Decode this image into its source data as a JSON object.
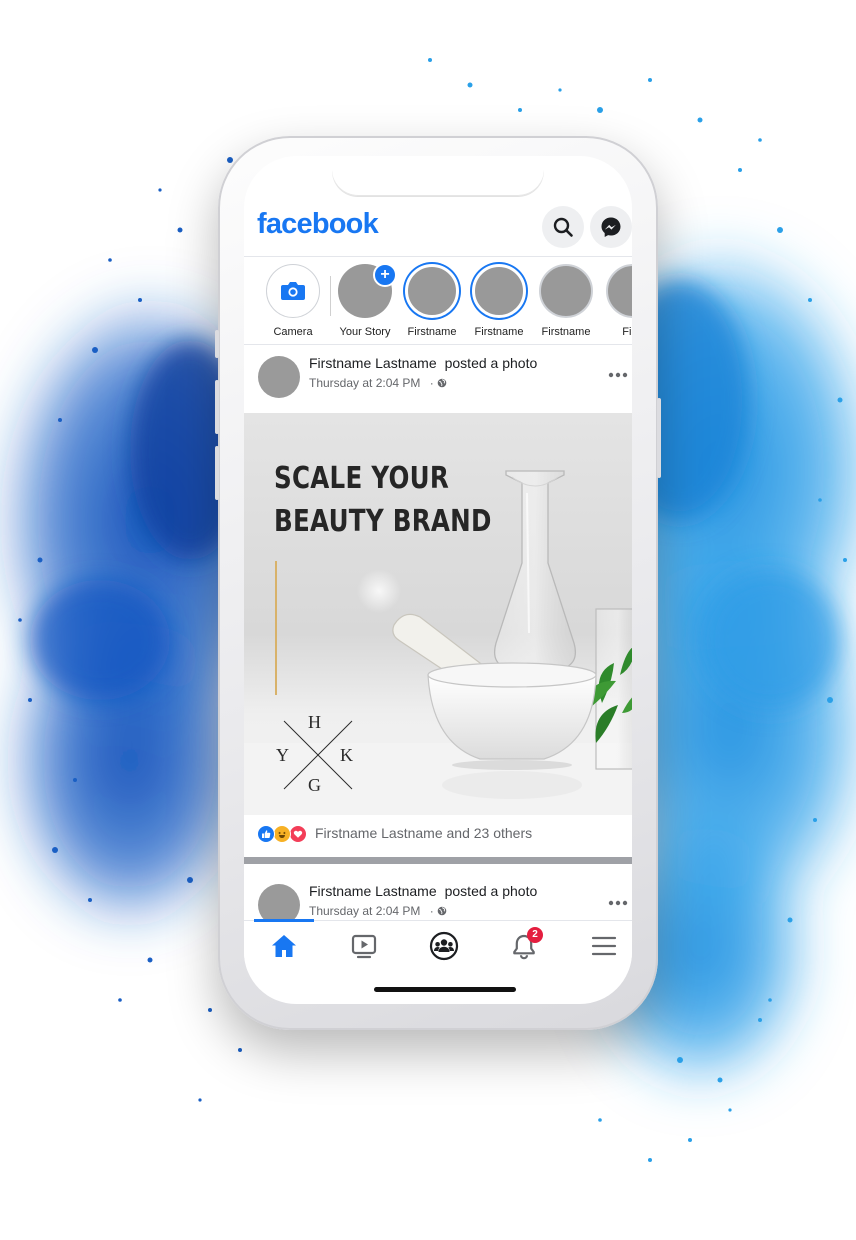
{
  "app": {
    "name": "facebook",
    "accent_color": "#1877f2",
    "icons": {
      "search": "search-icon",
      "messenger": "messenger-icon"
    }
  },
  "stories": [
    {
      "label": "Camera",
      "type": "camera",
      "icon": "camera-icon"
    },
    {
      "label": "Your Story",
      "type": "add",
      "icon": "plus-icon"
    },
    {
      "label": "Firstname",
      "type": "unseen"
    },
    {
      "label": "Firstname",
      "type": "unseen"
    },
    {
      "label": "Firstname",
      "type": "seen"
    },
    {
      "label": "First",
      "type": "seen"
    }
  ],
  "post": {
    "author": "Firstname Lastname",
    "action": "posted a photo",
    "time": "Thursday at 2:04 PM",
    "separator": "·",
    "privacy_icon": "globe-icon",
    "image": {
      "headline_line1": "SCALE YOUR",
      "headline_line2": "BEAUTY BRAND",
      "monogram": {
        "top": "H",
        "left": "Y",
        "right": "K",
        "bottom": "G"
      }
    },
    "reactions": {
      "types": [
        "like",
        "haha",
        "love"
      ],
      "text": "Firstname Lastname and 23 others"
    }
  },
  "post2": {
    "author": "Firstname Lastname",
    "action": "posted a photo",
    "time": "Thursday at 2:04 PM",
    "separator": "·"
  },
  "nav": {
    "items": [
      {
        "name": "home",
        "icon": "home-icon",
        "active": true
      },
      {
        "name": "watch",
        "icon": "video-icon",
        "active": false
      },
      {
        "name": "groups",
        "icon": "groups-icon",
        "active": false
      },
      {
        "name": "notifications",
        "icon": "bell-icon",
        "active": false,
        "badge": "2"
      },
      {
        "name": "menu",
        "icon": "hamburger-menu-icon",
        "active": false
      }
    ]
  }
}
